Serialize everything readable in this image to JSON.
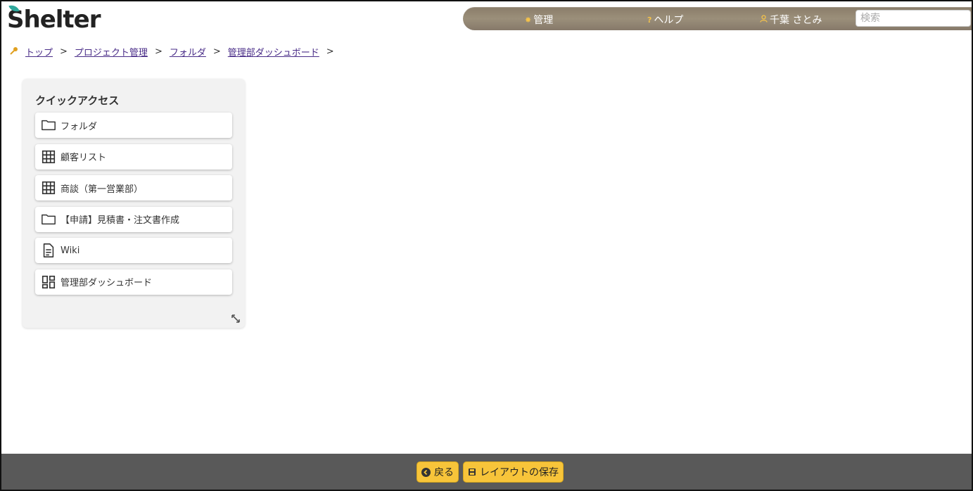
{
  "app": {
    "logo_text": "Shelter"
  },
  "topnav": {
    "admin": "管理",
    "help": "ヘルプ",
    "user": "千葉 さとみ",
    "search_placeholder": "検索"
  },
  "breadcrumb": [
    "トップ",
    "プロジェクト管理",
    "フォルダ",
    "管理部ダッシュボード"
  ],
  "breadcrumb_sep": ">",
  "quick_access": {
    "title": "クイックアクセス",
    "items": [
      {
        "label": "フォルダ",
        "icon": "folder-icon"
      },
      {
        "label": "顧客リスト",
        "icon": "table-icon"
      },
      {
        "label": "商談（第一営業部）",
        "icon": "table-icon"
      },
      {
        "label": "【申請】見積書・注文書作成",
        "icon": "folder-icon"
      },
      {
        "label": "Wiki",
        "icon": "document-icon"
      },
      {
        "label": "管理部ダッシュボード",
        "icon": "dashboard-icon"
      }
    ]
  },
  "footer": {
    "back": "戻る",
    "save_layout": "レイアウトの保存"
  },
  "colors": {
    "accent": "#f7c43a",
    "nav_bg": "#8a7d6a",
    "footer_bg": "#595959",
    "link": "#4a2d88"
  }
}
